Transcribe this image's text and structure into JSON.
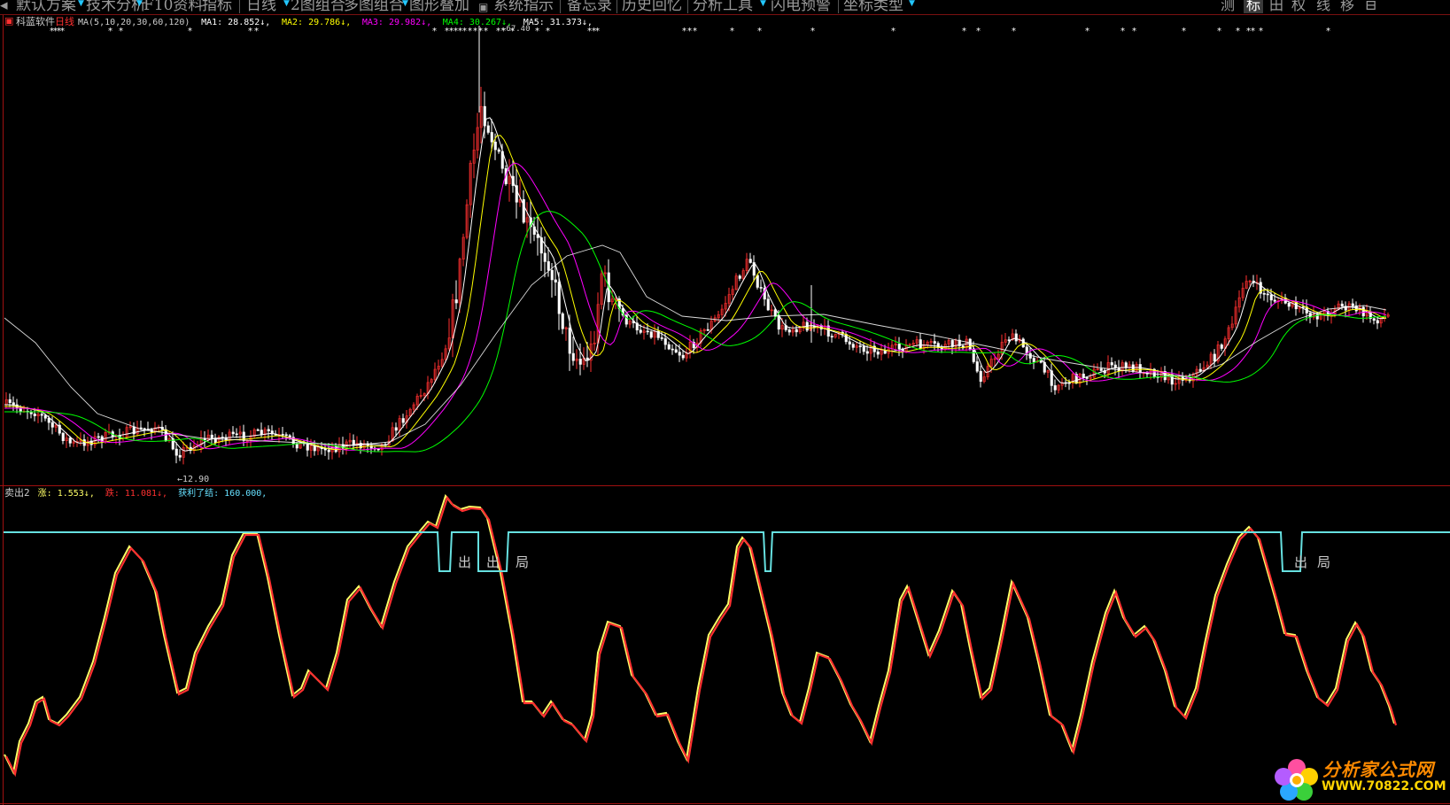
{
  "toolbar": {
    "items": [
      "默认方案",
      "技术分析",
      "F10资料",
      "指标",
      "日线",
      "2图组合",
      "多图组合",
      "图形叠加",
      "系统指示",
      "备忘录",
      "历史回忆",
      "分析工具",
      "闪电预警",
      "坐标类型"
    ],
    "right_buttons": [
      "测",
      "标",
      "田",
      "权",
      "线",
      "移"
    ],
    "active_right": "标"
  },
  "main_panel": {
    "stock_name": "科蓝软件",
    "period": "日线",
    "ma_label": "MA(5,10,20,30,60,120)",
    "ma_values": [
      {
        "label": "MA1:",
        "value": "28.852",
        "trend": "down",
        "color": "#ffffff"
      },
      {
        "label": "MA2:",
        "value": "29.786",
        "trend": "down",
        "color": "#ffff00"
      },
      {
        "label": "MA3:",
        "value": "29.982",
        "trend": "down",
        "color": "#ff00ff"
      },
      {
        "label": "MA4:",
        "value": "30.267",
        "trend": "down",
        "color": "#00ff00"
      },
      {
        "label": "MA5:",
        "value": "31.373",
        "trend": "down",
        "color": "#ffffff"
      }
    ],
    "high_label": "67.40",
    "low_label": "12.90"
  },
  "indicator_panel": {
    "name": "卖出2",
    "values": [
      {
        "label": "涨:",
        "value": "1.553",
        "trend": "down",
        "color": "#ffff66"
      },
      {
        "label": "跌:",
        "value": "11.081",
        "trend": "down",
        "color": "#ff3030"
      },
      {
        "label": "获利了结:",
        "value": "160.000,",
        "trend": "",
        "color": "#66e0ff"
      }
    ],
    "signal_labels": [
      "出",
      "出",
      "局",
      "出",
      "局"
    ]
  },
  "watermark": {
    "title": "分析家公式网",
    "url": "WWW.70822.COM"
  },
  "colors": {
    "background": "#000000",
    "frame": "#a01010",
    "up_candle": "#ff3030",
    "down_candle": "#ffffff",
    "ma1": "#ffffff",
    "ma2": "#ffff00",
    "ma3": "#ff00ff",
    "ma4": "#00ff00",
    "ma5": "#ffffff",
    "cyan": "#66e0e0",
    "osc_yellow": "#ffff66",
    "osc_red": "#ff3030"
  }
}
